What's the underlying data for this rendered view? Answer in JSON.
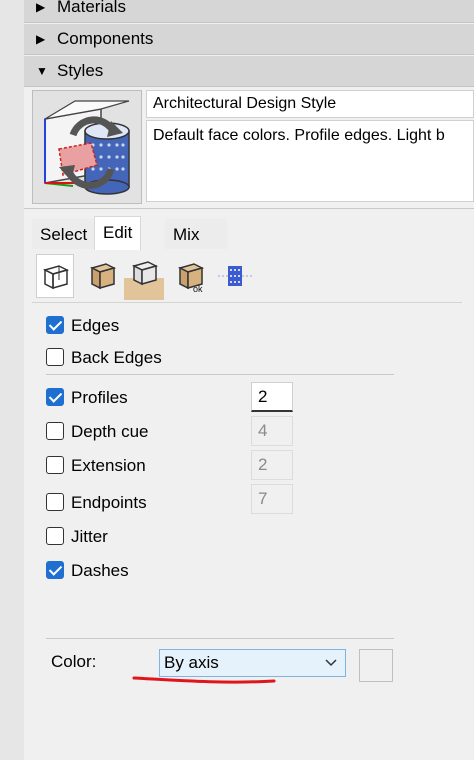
{
  "sections": {
    "materials": "Materials",
    "components": "Components",
    "styles": "Styles"
  },
  "style": {
    "name": "Architectural Design Style",
    "description": "Default face colors. Profile edges. Light b"
  },
  "tabs": [
    "Select",
    "Edit",
    "Mix"
  ],
  "active_tab": "Edit",
  "toolbar_icons": [
    "edge-settings-icon",
    "face-settings-icon",
    "background-settings-icon",
    "watermark-settings-icon",
    "modeling-settings-icon"
  ],
  "edges": [
    {
      "label": "Edges",
      "checked": true
    },
    {
      "label": "Back Edges",
      "checked": false
    },
    {
      "label": "Profiles",
      "checked": true,
      "value": "2",
      "enabled": true
    },
    {
      "label": "Depth cue",
      "checked": false,
      "value": "4",
      "enabled": false
    },
    {
      "label": "Extension",
      "checked": false,
      "value": "2",
      "enabled": false
    },
    {
      "label": "Endpoints",
      "checked": false,
      "value": "7",
      "enabled": false
    },
    {
      "label": "Jitter",
      "checked": false
    },
    {
      "label": "Dashes",
      "checked": true
    }
  ],
  "color": {
    "label": "Color:",
    "selected": "By axis"
  },
  "colors": {
    "accent": "#1f6fd1",
    "annotation": "#e0151b",
    "header_bg": "#d6d6d6"
  }
}
